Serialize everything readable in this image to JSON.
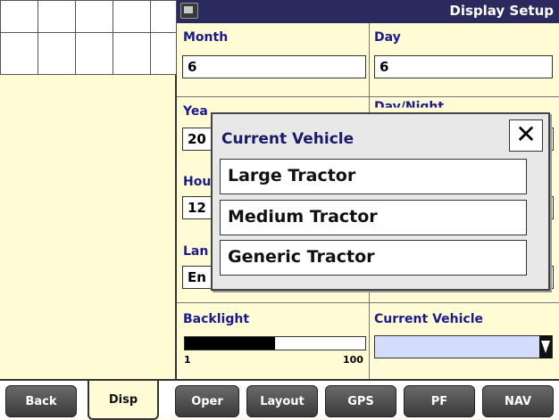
{
  "header": {
    "title": "Display Setup",
    "icon": "display-icon"
  },
  "fields": {
    "month": {
      "label": "Month",
      "value": "6"
    },
    "day": {
      "label": "Day",
      "value": "6"
    },
    "year": {
      "label": "Yea",
      "value": "20"
    },
    "day_night": {
      "label": "Day/Night"
    },
    "hour": {
      "label": "Hou",
      "value": "12"
    },
    "language": {
      "label": "Lan",
      "value": "En"
    },
    "backlight": {
      "label": "Backlight",
      "min": "1",
      "max": "100",
      "level_fraction": 0.5
    },
    "current_vehicle": {
      "label": "Current Vehicle",
      "value": ""
    }
  },
  "modal": {
    "title": "Current Vehicle",
    "close_glyph": "✕",
    "options": [
      "Large Tractor",
      "Medium Tractor",
      "Generic Tractor"
    ]
  },
  "tabs": [
    "Back",
    "Disp",
    "Oper",
    "Layout",
    "GPS",
    "PF",
    "NAV"
  ],
  "active_tab": "Disp",
  "colors": {
    "background": "#fffbd5",
    "title_bar": "#2a2a5e",
    "label": "#1a1a8a",
    "vehicle_field": "#d3dcfb"
  }
}
